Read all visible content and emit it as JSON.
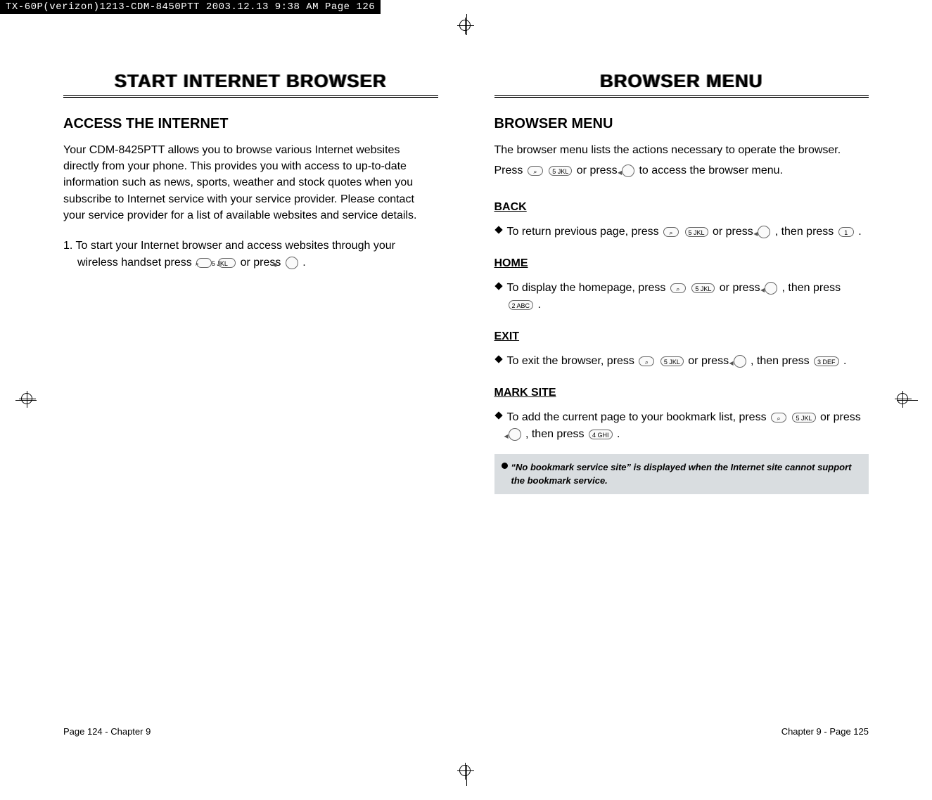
{
  "header_strip": "TX-60P(verizon)1213-CDM-8450PTT  2003.12.13  9:38 AM  Page 126",
  "left": {
    "title": "START INTERNET BROWSER",
    "heading": "ACCESS THE INTERNET",
    "intro": "Your CDM-8425PTT allows you to browse various Internet websites directly from your phone. This provides you with access to up-to-date information such as news, sports, weather and stock quotes when you subscribe to Internet service with your service provider. Please contact your service provider for a list of available websites and service details.",
    "step1_a": "1. To start your Internet browser and access websites through your wireless handset press ",
    "step1_b": " or press ",
    "step1_c": " .",
    "footer": "Page 124 - Chapter 9"
  },
  "right": {
    "title": "BROWSER MENU",
    "heading": "BROWSER MENU",
    "intro_a": "The browser menu lists the actions necessary to operate the browser.",
    "intro_b1": "Press ",
    "intro_b2": " or press ",
    "intro_b3": " to access the browser menu.",
    "back": {
      "label": "BACK",
      "line_a": "To return previous page, press ",
      "line_b": " or press ",
      "line_c": " , then press ",
      "line_d": " ."
    },
    "home": {
      "label": "HOME",
      "line_a": "To display the homepage, press ",
      "line_b": " or press ",
      "line_c": " , then press ",
      "line_d": " ."
    },
    "exit": {
      "label": "EXIT",
      "line_a": "To exit the browser, press ",
      "line_b": " or press ",
      "line_c": " , then press ",
      "line_d": " ."
    },
    "mark": {
      "label": "MARK SITE",
      "line_a": "To add the current page to your bookmark list, press ",
      "line_b": " or press ",
      "line_c": " , then press ",
      "line_d": " ."
    },
    "note": "“No bookmark service site” is displayed when the Internet site cannot support the bookmark service.",
    "footer": "Chapter 9 - Page 125"
  },
  "keys": {
    "soft": "⌕",
    "five": "5 JKL",
    "nav": "●",
    "one": "1",
    "two": "2 ABC",
    "three": "3 DEF",
    "four": "4 GHI"
  }
}
